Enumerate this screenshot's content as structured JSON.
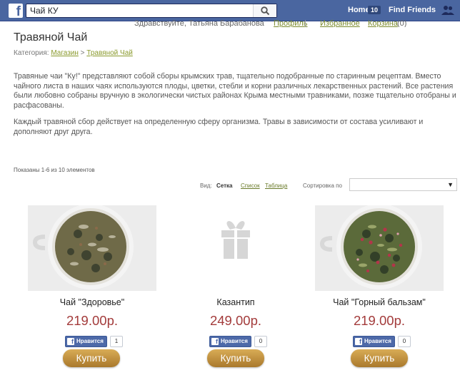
{
  "fbbar": {
    "logo": "f",
    "search_value": "Чай КУ",
    "home_label": "Home",
    "home_badge": "10",
    "find_friends_label": "Find Friends"
  },
  "userbar": {
    "greeting": "Здравствуйте, Татьяна Барабанова",
    "profile_link": "Профиль",
    "separator": "|",
    "favorites_link": "Избранное",
    "cart_link": "Корзина",
    "cart_count": "(0)"
  },
  "page": {
    "title": "Травяной Чай",
    "breadcrumb_prefix": "Категория:",
    "breadcrumb_shop": "Магазин",
    "breadcrumb_sep": ">",
    "breadcrumb_current": "Травяной Чай",
    "description_1": "Травяные чаи \"Ку!\" представляют собой сборы крымских трав, тщательно подобранные по старинным рецептам. Вместо чайного листа в наших чаях используются плоды, цветки, стебли и корни различных лекарственных растений. Все растения были любовно собраны вручную в экологически чистых районах Крыма местными травниками, позже тщательно отобраны и расфасованы.",
    "description_2": "Каждый травяной сбор действует на определенную сферу организма. Травы в зависимости от состава усиливают и дополняют друг друга.",
    "count_text": "Показаны 1-6 из 10 элементов"
  },
  "view": {
    "label": "Вид:",
    "grid": "Сетка",
    "list": "Список",
    "table": "Таблица",
    "sort_label": "Сортировка по",
    "sort_value": ""
  },
  "products": [
    {
      "name": "Чай \"Здоровье\"",
      "price": "219.00р.",
      "like_label": "Нравится",
      "like_count": "1",
      "buy_label": "Купить",
      "image_icon": "tea-cup-image"
    },
    {
      "name": "Казантип",
      "price": "249.00р.",
      "like_label": "Нравится",
      "like_count": "0",
      "buy_label": "Купить",
      "image_icon": "gift-icon"
    },
    {
      "name": "Чай \"Горный бальзам\"",
      "price": "219.00р.",
      "like_label": "Нравится",
      "like_count": "0",
      "buy_label": "Купить",
      "image_icon": "tea-cup-image"
    }
  ],
  "colors": {
    "fb_blue": "#4a66a0",
    "link_green": "#8a9a2d",
    "price_red": "#a33b3b",
    "buy_gold": "#c9983f"
  }
}
